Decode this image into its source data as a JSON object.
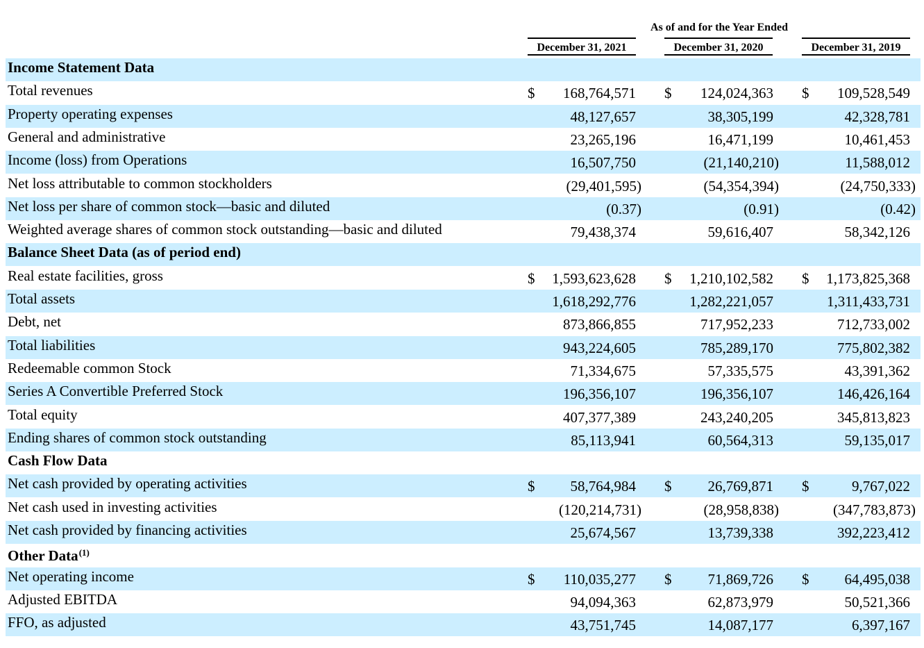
{
  "header": {
    "period_title": "As of and for the Year Ended",
    "columns": [
      "December 31, 2021",
      "December 31, 2020",
      "December 31, 2019"
    ]
  },
  "rows": [
    {
      "label": "Income Statement Data",
      "section": true
    },
    {
      "label": "Total revenues",
      "dollar": true,
      "values": [
        "168,764,571",
        "124,024,363",
        "109,528,549"
      ]
    },
    {
      "label": "Property operating expenses",
      "values": [
        "48,127,657",
        "38,305,199",
        "42,328,781"
      ]
    },
    {
      "label": "General and administrative",
      "values": [
        "23,265,196",
        "16,471,199",
        "10,461,453"
      ]
    },
    {
      "label": "Income (loss) from Operations",
      "values": [
        "16,507,750",
        "(21,140,210)",
        "11,588,012"
      ]
    },
    {
      "label": "Net loss attributable to common stockholders",
      "values": [
        "(29,401,595)",
        "(54,354,394)",
        "(24,750,333)"
      ]
    },
    {
      "label": "Net loss per share of common stock—basic and diluted",
      "values": [
        "(0.37)",
        "(0.91)",
        "(0.42)"
      ]
    },
    {
      "label": "Weighted average shares of common stock outstanding—basic and diluted",
      "values": [
        "79,438,374",
        "59,616,407",
        "58,342,126"
      ]
    },
    {
      "label": "Balance Sheet Data (as of period end)",
      "section": true
    },
    {
      "label": "Real estate facilities, gross",
      "dollar": true,
      "values": [
        "1,593,623,628",
        "1,210,102,582",
        "1,173,825,368"
      ]
    },
    {
      "label": "Total assets",
      "values": [
        "1,618,292,776",
        "1,282,221,057",
        "1,311,433,731"
      ]
    },
    {
      "label": "Debt, net",
      "values": [
        "873,866,855",
        "717,952,233",
        "712,733,002"
      ]
    },
    {
      "label": "Total liabilities",
      "values": [
        "943,224,605",
        "785,289,170",
        "775,802,382"
      ]
    },
    {
      "label": "Redeemable common Stock",
      "values": [
        "71,334,675",
        "57,335,575",
        "43,391,362"
      ]
    },
    {
      "label": "Series A Convertible Preferred Stock",
      "values": [
        "196,356,107",
        "196,356,107",
        "146,426,164"
      ]
    },
    {
      "label": "Total equity",
      "values": [
        "407,377,389",
        "243,240,205",
        "345,813,823"
      ]
    },
    {
      "label": "Ending shares of common stock outstanding",
      "values": [
        "85,113,941",
        "60,564,313",
        "59,135,017"
      ]
    },
    {
      "label": "Cash Flow Data",
      "section": true
    },
    {
      "label": "Net cash provided by operating activities",
      "dollar": true,
      "values": [
        "58,764,984",
        "26,769,871",
        "9,767,022"
      ]
    },
    {
      "label": "Net cash used in investing activities",
      "values": [
        "(120,214,731)",
        "(28,958,838)",
        "(347,783,873)"
      ]
    },
    {
      "label": "Net cash provided by financing activities",
      "values": [
        "25,674,567",
        "13,739,338",
        "392,223,412"
      ]
    },
    {
      "label": "Other Data",
      "section": true,
      "note": "(1)"
    },
    {
      "label": "Net operating income",
      "dollar": true,
      "values": [
        "110,035,277",
        "71,869,726",
        "64,495,038"
      ]
    },
    {
      "label": "Adjusted EBITDA",
      "values": [
        "94,094,363",
        "62,873,979",
        "50,521,366"
      ]
    },
    {
      "label": "FFO, as adjusted",
      "values": [
        "43,751,745",
        "14,087,177",
        "6,397,167"
      ]
    }
  ],
  "currency_symbol": "$",
  "colors": {
    "row_shade": "#cceeff",
    "text": "#000000"
  }
}
